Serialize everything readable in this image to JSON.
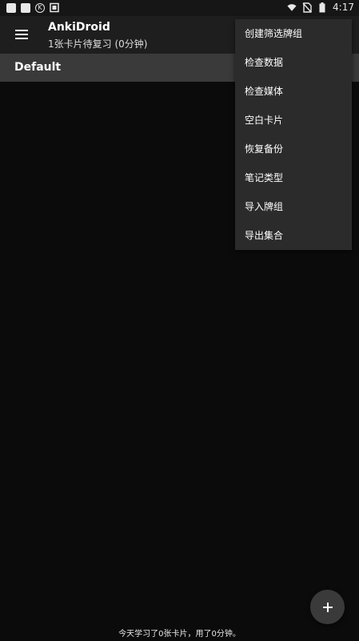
{
  "status_bar": {
    "time": "4:17",
    "circle_badge": "K"
  },
  "app_bar": {
    "title": "AnkiDroid",
    "subtitle": "1张卡片待复习 (0分钟)"
  },
  "deck_list": {
    "items": [
      {
        "name": "Default"
      }
    ]
  },
  "overflow_menu": {
    "items": [
      {
        "label": "创建筛选牌组"
      },
      {
        "label": "检查数据"
      },
      {
        "label": "检查媒体"
      },
      {
        "label": "空白卡片"
      },
      {
        "label": "恢复备份"
      },
      {
        "label": "笔记类型"
      },
      {
        "label": "导入牌组"
      },
      {
        "label": "导出集合"
      }
    ]
  },
  "footer": {
    "stats_text": "今天学习了0张卡片，用了0分钟。"
  },
  "icons": {
    "fab": "plus-icon",
    "nav": "hamburger-menu-icon"
  },
  "colors": {
    "background": "#0b0b0b",
    "app_bar": "#1e1e1e",
    "deck_row": "#3a3a3a",
    "menu": "#2b2b2b"
  }
}
